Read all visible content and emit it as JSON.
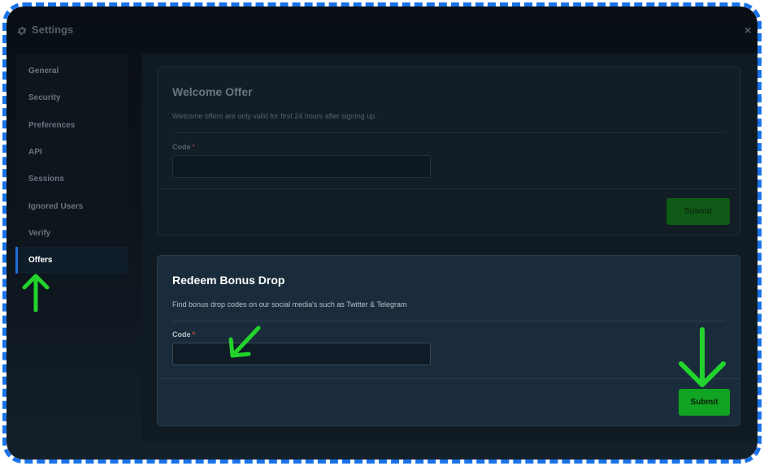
{
  "modal": {
    "title": "Settings",
    "title_icon": "gear-icon",
    "close_label": "×"
  },
  "sidebar": {
    "items": [
      {
        "label": "General"
      },
      {
        "label": "Security"
      },
      {
        "label": "Preferences"
      },
      {
        "label": "API"
      },
      {
        "label": "Sessions"
      },
      {
        "label": "Ignored Users"
      },
      {
        "label": "Verify"
      },
      {
        "label": "Offers"
      }
    ],
    "active": "Offers"
  },
  "welcome_offer": {
    "title": "Welcome Offer",
    "description": "Welcome offers are only valid for first 24 hours after signing up.",
    "code_label": "Code",
    "required_mark": "*",
    "code_value": "",
    "submit_label": "Submit"
  },
  "bonus_drop": {
    "title": "Redeem Bonus Drop",
    "description": "Find bonus drop codes on our social media's such as Twitter & Telegram",
    "code_label": "Code",
    "required_mark": "*",
    "code_value": "",
    "submit_label": "Submit"
  },
  "annotations": {
    "arrow_color": "#22d32c",
    "arrows": [
      "arrow-up-icon",
      "arrow-down-left-icon",
      "arrow-down-icon"
    ]
  },
  "colors": {
    "frame_border": "#1a73e8",
    "active_accent": "#1e6fd9",
    "submit_green": "#11a322",
    "required_red": "#d24545"
  }
}
